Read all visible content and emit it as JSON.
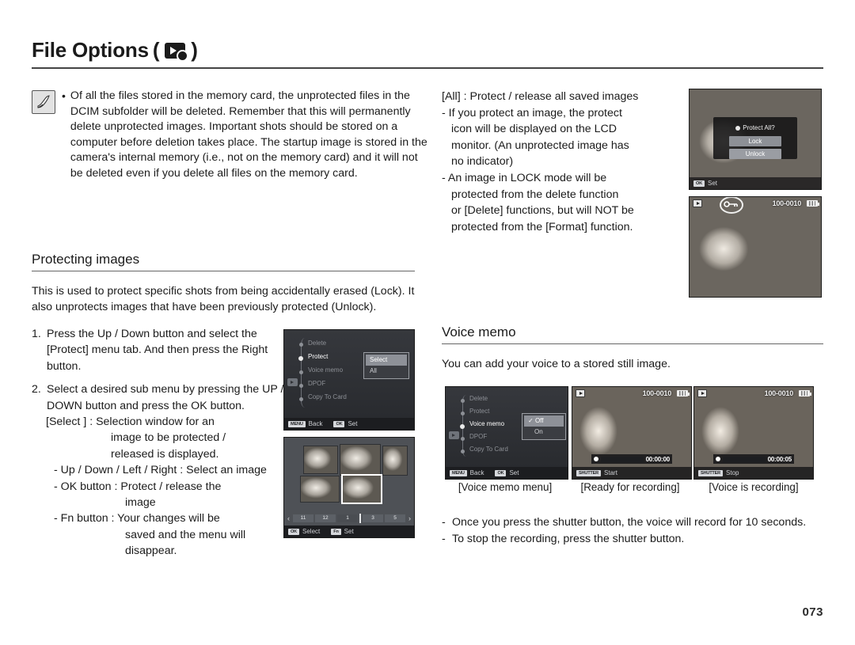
{
  "header": {
    "title": "File Options",
    "paren_open": "(",
    "paren_close": ")",
    "icon": "playback-settings-icon"
  },
  "note": {
    "icon": "pen-note-icon",
    "bullet": "•",
    "text": "Of all the files stored in the memory card, the unprotected files in the DCIM subfolder will be deleted. Remember that this will permanently delete unprotected images. Important shots should be stored on a computer before deletion takes place. The startup image is stored in the camera's internal memory (i.e., not on the memory card) and it will not be deleted even if you delete all files on the memory card."
  },
  "right_top": {
    "lines": [
      "[All] : Protect / release all saved images",
      "- If you protect an image, the protect",
      "icon will be displayed on the LCD",
      "monitor. (An unprotected image has",
      "no indicator)",
      "- An image in LOCK mode will be",
      "protected from the delete function",
      "or [Delete] functions, but will NOT be",
      "protected from the [Format] function."
    ]
  },
  "protecting": {
    "title": "Protecting images",
    "description": "This is used to protect specific shots from being accidentally erased (Lock). It also unprotects images that have been previously protected (Unlock).",
    "steps": [
      {
        "num": "1.",
        "text": "Press the Up / Down button and select the [Protect] menu tab. And then press the Right button."
      },
      {
        "num": "2.",
        "text": "Select a desired sub menu by pressing the UP / DOWN button and press the OK button."
      }
    ],
    "sub_lines": [
      "[Select ] : Selection window for an",
      "image to be protected /",
      "released is displayed.",
      "- Up / Down / Left / Right : Select an image",
      "- OK button : Protect / release the",
      "image",
      "- Fn button : Your changes will be",
      "saved and the menu will",
      "disappear."
    ]
  },
  "voice_memo": {
    "title": "Voice memo",
    "description": "You can add your voice to a stored still image.",
    "captions": [
      "[Voice memo menu]",
      "[Ready for recording]",
      "[Voice is recording]"
    ],
    "bullets": [
      "Once you press the shutter button, the voice will record for 10 seconds.",
      "To stop the recording, press the shutter button."
    ],
    "dash": "-"
  },
  "lcd_protect_menu": {
    "name": "protect-menu-screen",
    "menu_items": [
      "Delete",
      "Protect",
      "Voice memo",
      "DPOF",
      "Copy To Card"
    ],
    "active_index": 1,
    "submenu": [
      "Select",
      "All"
    ],
    "submenu_selected_index": 0,
    "bottom": [
      {
        "key": "MENU",
        "label": "Back"
      },
      {
        "key": "OK",
        "label": "Set"
      }
    ]
  },
  "lcd_select_grid": {
    "name": "image-select-screen",
    "filmstrip": [
      "11",
      "12",
      "1",
      "3",
      "5"
    ],
    "arrow_left": "‹",
    "arrow_right": "›",
    "bottom": [
      {
        "key": "OK",
        "label": "Select"
      },
      {
        "key": "Fn",
        "label": "Set"
      }
    ]
  },
  "lcd_protect_all": {
    "name": "protect-all-dialog-screen",
    "dialog_title": "Protect All?",
    "buttons": [
      "Lock",
      "Unlock"
    ],
    "bottom": [
      {
        "key": "OK",
        "label": "Set"
      }
    ]
  },
  "lcd_protected_image": {
    "name": "protected-image-screen",
    "file_number": "100-0010",
    "protect_icon": "key-lock-icon"
  },
  "lcd_voice_menu": {
    "name": "voice-memo-menu-screen",
    "menu_items": [
      "Delete",
      "Protect",
      "Voice memo",
      "DPOF",
      "Copy To Card"
    ],
    "active_index": 2,
    "submenu": [
      "Off",
      "On"
    ],
    "submenu_selected_index": 0,
    "check_mark": "✓",
    "bottom": [
      {
        "key": "MENU",
        "label": "Back"
      },
      {
        "key": "OK",
        "label": "Set"
      }
    ]
  },
  "lcd_ready_record": {
    "name": "ready-for-recording-screen",
    "file_number": "100-0010",
    "timer": "00:00:00",
    "progress_percent": 0,
    "bottom": [
      {
        "key": "SHUTTER",
        "label": "Start"
      }
    ]
  },
  "lcd_recording": {
    "name": "voice-recording-screen",
    "file_number": "100-0010",
    "timer": "00:00:05",
    "progress_percent": 30,
    "bottom": [
      {
        "key": "SHUTTER",
        "label": "Stop"
      }
    ]
  },
  "page_number": "073",
  "colors": {
    "text": "#1b1b1b",
    "rule": "#444444",
    "lcd_bg": "#2f3136",
    "lcd_highlight": "#8e9198"
  }
}
